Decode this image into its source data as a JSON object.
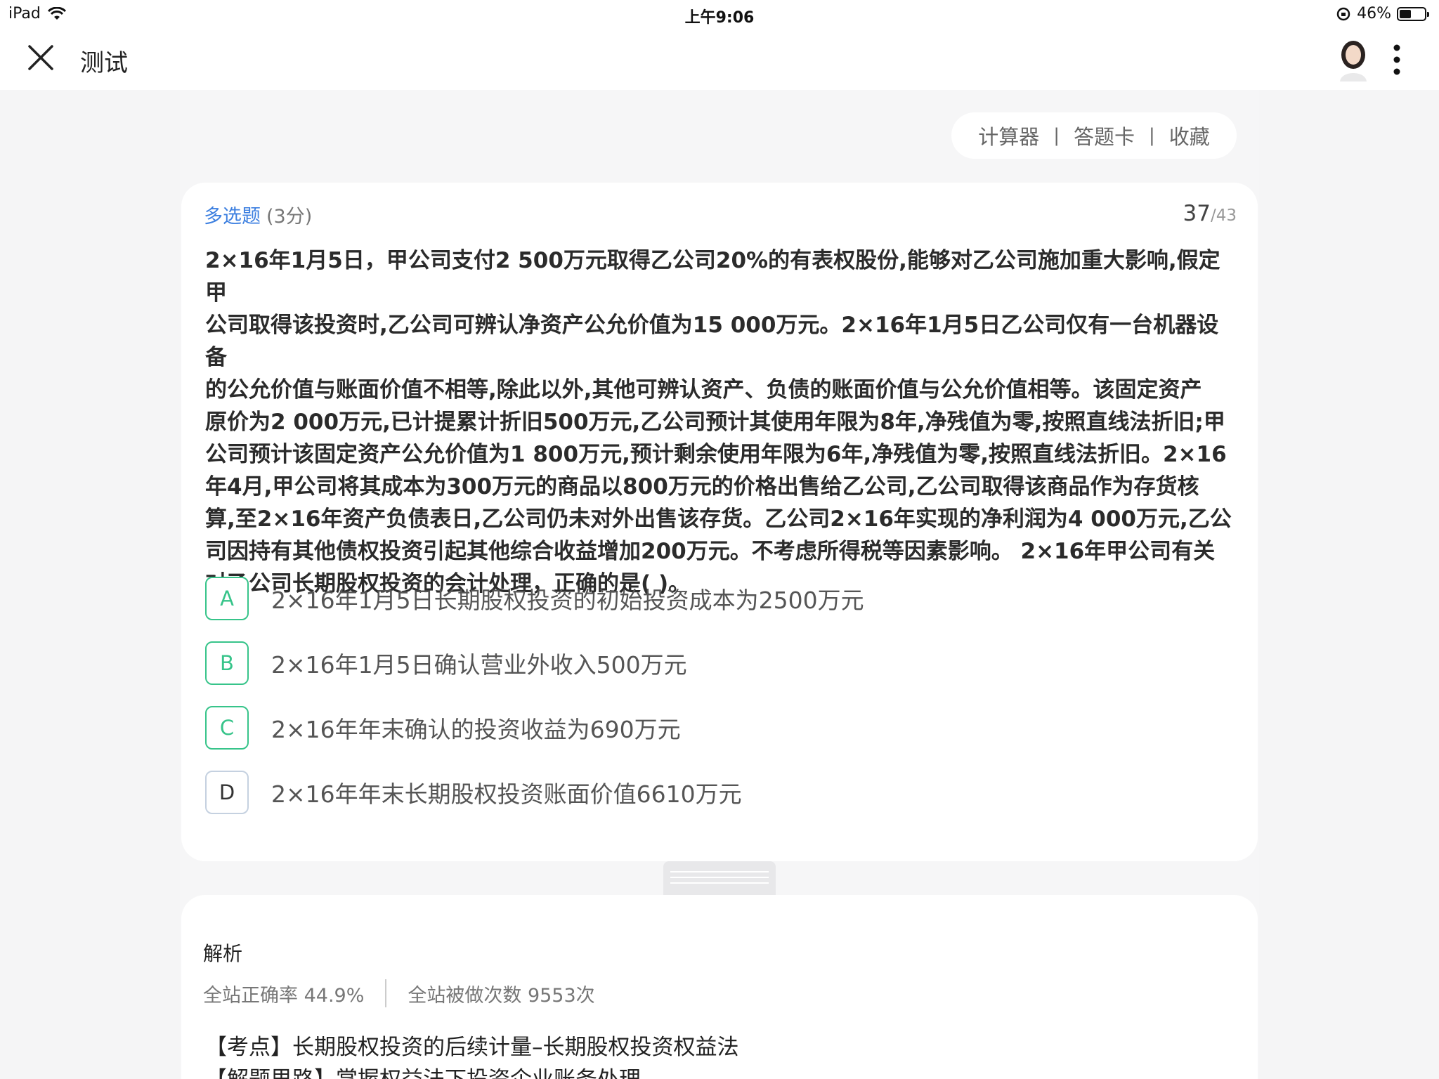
{
  "status_bar": {
    "device": "iPad",
    "time": "上午9:06",
    "battery": "46%",
    "battery_level": 0.46
  },
  "nav": {
    "title": "测试"
  },
  "toolbar": {
    "calculator": "计算器",
    "answer_card": "答题卡",
    "favorite": "收藏",
    "separator": "|"
  },
  "question": {
    "type": "多选题",
    "score": "(3分)",
    "current": "37",
    "total": "/43",
    "lines": [
      "2×16年1月5日，甲公司支付2 500万元取得乙公司20%的有表权股份,能够对乙公司施加重大影响,假定甲",
      "公司取得该投资时,乙公司可辨认净资产公允价值为15 000万元。2×16年1月5日乙公司仅有一台机器设备",
      "的公允价值与账面价值不相等,除此以外,其他可辨认资产、负债的账面价值与公允价值相等。该固定资产",
      "原价为2 000万元,已计提累计折旧500万元,乙公司预计其使用年限为8年,净残值为零,按照直线法折旧;甲",
      "公司预计该固定资产公允价值为1 800万元,预计剩余使用年限为6年,净残值为零,按照直线法折旧。2×16",
      "年4月,甲公司将其成本为300万元的商品以800万元的价格出售给乙公司,乙公司取得该商品作为存货核",
      "算,至2×16年资产负债表日,乙公司仍未对外出售该存货。乙公司2×16年实现的净利润为4 000万元,乙公",
      "司因持有其他债权投资引起其他综合收益增加200万元。不考虑所得税等因素影响。 2×16年甲公司有关",
      "对乙公司长期股权投资的会计处理，正确的是( )。"
    ],
    "options": [
      {
        "letter": "A",
        "text": "2×16年1月5日长期股权投资的初始投资成本为2500万元",
        "selected": true
      },
      {
        "letter": "B",
        "text": "2×16年1月5日确认营业外收入500万元",
        "selected": true
      },
      {
        "letter": "C",
        "text": "2×16年年末确认的投资收益为690万元",
        "selected": true
      },
      {
        "letter": "D",
        "text": "2×16年年末长期股权投资账面价值6610万元",
        "selected": false
      }
    ]
  },
  "analysis": {
    "title": "解析",
    "accuracy": "全站正确率 44.9%",
    "attempts": "全站被做次数 9553次",
    "line1": "【考点】长期股权投资的后续计量–长期股权投资权益法",
    "line2": "【解题思路】掌握权益法下投资企业账务处理"
  },
  "colors": {
    "accent_blue": "#3c7fe0",
    "selected_green": "#37c48a",
    "background": "#f5f5f6"
  }
}
